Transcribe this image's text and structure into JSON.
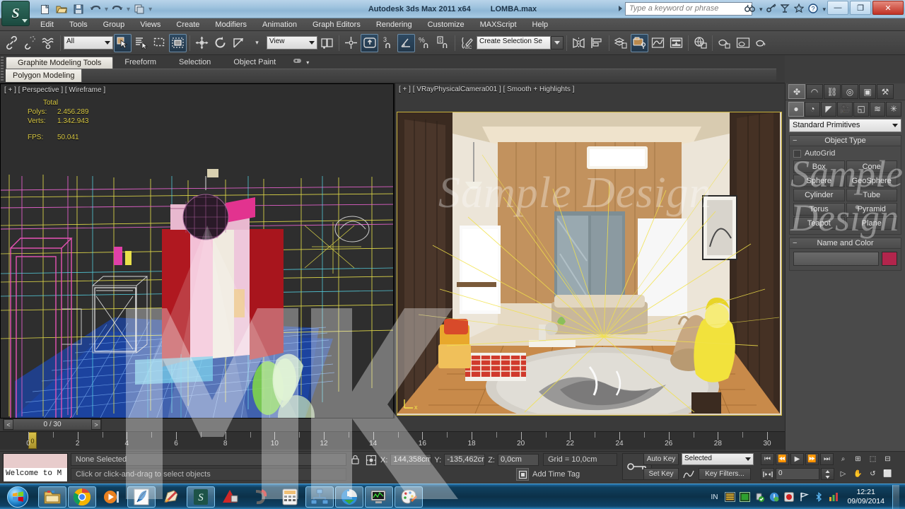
{
  "titlebar": {
    "app_title": "Autodesk 3ds Max  2011 x64",
    "file_name": "LOMBA.max",
    "search_placeholder": "Type a keyword or phrase",
    "logo_letter": "S",
    "quick_access": [
      {
        "name": "new-file",
        "glyph": "⬜"
      },
      {
        "name": "open-file",
        "glyph": "📂"
      },
      {
        "name": "save-file",
        "glyph": "💾"
      },
      {
        "name": "undo",
        "glyph": "↶"
      },
      {
        "name": "redo",
        "glyph": "↷"
      },
      {
        "name": "project-folder",
        "glyph": "🗂"
      }
    ],
    "help_icons": [
      {
        "name": "search-binoculars",
        "glyph": "♋"
      },
      {
        "name": "key-help",
        "glyph": "⚷"
      },
      {
        "name": "subscription",
        "glyph": "◢"
      },
      {
        "name": "favorites-star",
        "glyph": "☆"
      },
      {
        "name": "help",
        "glyph": "?"
      }
    ],
    "window_buttons": [
      {
        "name": "minimize",
        "glyph": "—"
      },
      {
        "name": "restore",
        "glyph": "❐"
      },
      {
        "name": "close",
        "glyph": "✕"
      }
    ]
  },
  "menubar": {
    "items": [
      "Edit",
      "Tools",
      "Group",
      "Views",
      "Create",
      "Modifiers",
      "Animation",
      "Graph Editors",
      "Rendering",
      "Customize",
      "MAXScript",
      "Help"
    ]
  },
  "toolbar": {
    "selection_filter": "All",
    "reference_coord": "View",
    "named_selection_set": "Create Selection Se",
    "buttons": [
      {
        "name": "select-and-link",
        "glyph": "⚭"
      },
      {
        "name": "unlink-selection",
        "glyph": "⚮"
      },
      {
        "name": "bind-to-space-warp",
        "glyph": "≋"
      },
      {
        "name": "select-object",
        "glyph": "↖"
      },
      {
        "name": "select-by-name",
        "glyph": "≡"
      },
      {
        "name": "select-region",
        "glyph": "⬚"
      },
      {
        "name": "window-crossing",
        "glyph": "▣"
      },
      {
        "name": "select-and-move",
        "glyph": "✥"
      },
      {
        "name": "select-and-rotate",
        "glyph": "↻"
      },
      {
        "name": "select-and-scale",
        "glyph": "⤡"
      },
      {
        "name": "use-center-flyout",
        "glyph": "◱"
      },
      {
        "name": "select-and-manipulate",
        "glyph": "⊕"
      },
      {
        "name": "snaps-toggle",
        "glyph": "⬡"
      },
      {
        "name": "angle-snap-toggle",
        "glyph": "∠"
      },
      {
        "name": "percent-snap-toggle",
        "glyph": "%"
      },
      {
        "name": "spinner-snap-toggle",
        "glyph": "⇅"
      },
      {
        "name": "edit-named-selection-sets",
        "glyph": "✐"
      },
      {
        "name": "mirror",
        "glyph": "◧"
      },
      {
        "name": "align",
        "glyph": "☰"
      },
      {
        "name": "layer-manager",
        "glyph": "☲"
      },
      {
        "name": "curve-editor",
        "glyph": "∿"
      },
      {
        "name": "schematic-view",
        "glyph": "⊞"
      },
      {
        "name": "material-editor",
        "glyph": "◐"
      },
      {
        "name": "render-setup",
        "glyph": "⚙"
      },
      {
        "name": "rendered-frame-window",
        "glyph": "⬛"
      },
      {
        "name": "render-production",
        "glyph": "◷"
      }
    ]
  },
  "ribbon": {
    "tabs": [
      "Graphite Modeling Tools",
      "Freeform",
      "Selection",
      "Object Paint"
    ],
    "active_tab": "Graphite Modeling Tools",
    "panel_label": "Polygon Modeling"
  },
  "viewports": {
    "left": {
      "label": "[ + ] [ Perspective ] [ Wireframe ]",
      "stats": {
        "total_label": "Total",
        "polys_label": "Polys:",
        "polys_value": "2.456.289",
        "verts_label": "Verts:",
        "verts_value": "1.342.943",
        "fps_label": "FPS:",
        "fps_value": "50.041"
      }
    },
    "right": {
      "label": "[ + ] [ VRayPhysicalCamera001 ] [ Smooth + Highlights ]"
    },
    "watermark": "Sample Design"
  },
  "timeline": {
    "slider_value": "0 / 30",
    "prev_arrow": "<",
    "next_arrow": ">",
    "ticks": [
      0,
      2,
      4,
      6,
      8,
      10,
      12,
      14,
      16,
      18,
      20,
      22,
      24,
      26,
      28,
      30
    ],
    "range_start": 0,
    "range_end": 30,
    "current_frame": 0
  },
  "command_panel": {
    "tabs": [
      {
        "name": "create-tab",
        "glyph": "✤",
        "active": true
      },
      {
        "name": "modify-tab",
        "glyph": "◠"
      },
      {
        "name": "hierarchy-tab",
        "glyph": "⛓"
      },
      {
        "name": "motion-tab",
        "glyph": "◎"
      },
      {
        "name": "display-tab",
        "glyph": "▣"
      },
      {
        "name": "utilities-tab",
        "glyph": "⚒"
      }
    ],
    "object_categories": [
      {
        "name": "geometry",
        "glyph": "●",
        "active": true
      },
      {
        "name": "shapes",
        "glyph": "◔"
      },
      {
        "name": "lights",
        "glyph": "◤"
      },
      {
        "name": "cameras",
        "glyph": "🎥"
      },
      {
        "name": "helpers",
        "glyph": "◱"
      },
      {
        "name": "space-warps",
        "glyph": "≋"
      },
      {
        "name": "systems",
        "glyph": "✳"
      }
    ],
    "category_dropdown": "Standard Primitives",
    "object_type": {
      "title": "Object Type",
      "autogrid_label": "AutoGrid",
      "buttons": [
        "Box",
        "Cone",
        "Sphere",
        "GeoSphere",
        "Cylinder",
        "Tube",
        "Torus",
        "Pyramid",
        "Teapot",
        "Plane"
      ]
    },
    "name_and_color": {
      "title": "Name and Color",
      "name_value": "",
      "color": "#b2254c"
    }
  },
  "statusbar": {
    "maxscript_listener": "Welcome to M",
    "selection_status": "None Selected",
    "prompt": "Click or click-and-drag to select objects",
    "coords": {
      "x_label": "X:",
      "x_value": "144,358cm",
      "y_label": "Y:",
      "y_value": "-135,462cm",
      "z_label": "Z:",
      "z_value": "0,0cm"
    },
    "grid_info": "Grid = 10,0cm",
    "add_time_tag": "Add Time Tag",
    "auto_key": "Auto Key",
    "set_key": "Set Key",
    "key_mode_selected": "Selected",
    "key_filters": "Key Filters...",
    "frame_value": "0",
    "playback_buttons": [
      {
        "name": "go-to-start",
        "glyph": "⏮"
      },
      {
        "name": "previous-frame",
        "glyph": "⏪"
      },
      {
        "name": "play-animation",
        "glyph": "▶"
      },
      {
        "name": "next-frame",
        "glyph": "⏩"
      },
      {
        "name": "go-to-end",
        "glyph": "⏭"
      }
    ],
    "nav_buttons": [
      {
        "name": "zoom",
        "glyph": "⌕"
      },
      {
        "name": "zoom-extents",
        "glyph": "⊞"
      },
      {
        "name": "zoom-region",
        "glyph": "⬚"
      },
      {
        "name": "zoom-all",
        "glyph": "⊟"
      },
      {
        "name": "field-of-view",
        "glyph": "▷"
      },
      {
        "name": "pan-view",
        "glyph": "✋"
      },
      {
        "name": "orbit",
        "glyph": "↺"
      },
      {
        "name": "maximize-viewport",
        "glyph": "⬜"
      }
    ]
  },
  "taskbar": {
    "start_label": "Start",
    "items": [
      {
        "name": "windows-explorer",
        "running": true
      },
      {
        "name": "google-chrome",
        "running": true
      },
      {
        "name": "media-player",
        "running": false
      },
      {
        "name": "dreamweaver-feather",
        "running": true
      },
      {
        "name": "paint-pencil",
        "running": false
      },
      {
        "name": "3ds-max",
        "running": true
      },
      {
        "name": "autocad",
        "running": false
      },
      {
        "name": "sketchup",
        "running": false
      },
      {
        "name": "calculator",
        "running": false
      },
      {
        "name": "network-app",
        "running": true
      },
      {
        "name": "download-manager",
        "running": true
      },
      {
        "name": "monitor-app",
        "running": true
      },
      {
        "name": "paint-palette",
        "running": true
      }
    ],
    "language": "IN",
    "tray_icons": [
      {
        "name": "equalizer-icon"
      },
      {
        "name": "screen-icon"
      },
      {
        "name": "usb-safe-remove-icon"
      },
      {
        "name": "update-icon"
      },
      {
        "name": "antivirus-icon"
      },
      {
        "name": "flag-action-center-icon"
      },
      {
        "name": "bluetooth-icon"
      },
      {
        "name": "stats-icon"
      },
      {
        "name": "network-icon"
      },
      {
        "name": "hand-icon"
      },
      {
        "name": "display-icon"
      },
      {
        "name": "volume-icon"
      }
    ],
    "clock_time": "12:21",
    "clock_date": "09/09/2014"
  }
}
